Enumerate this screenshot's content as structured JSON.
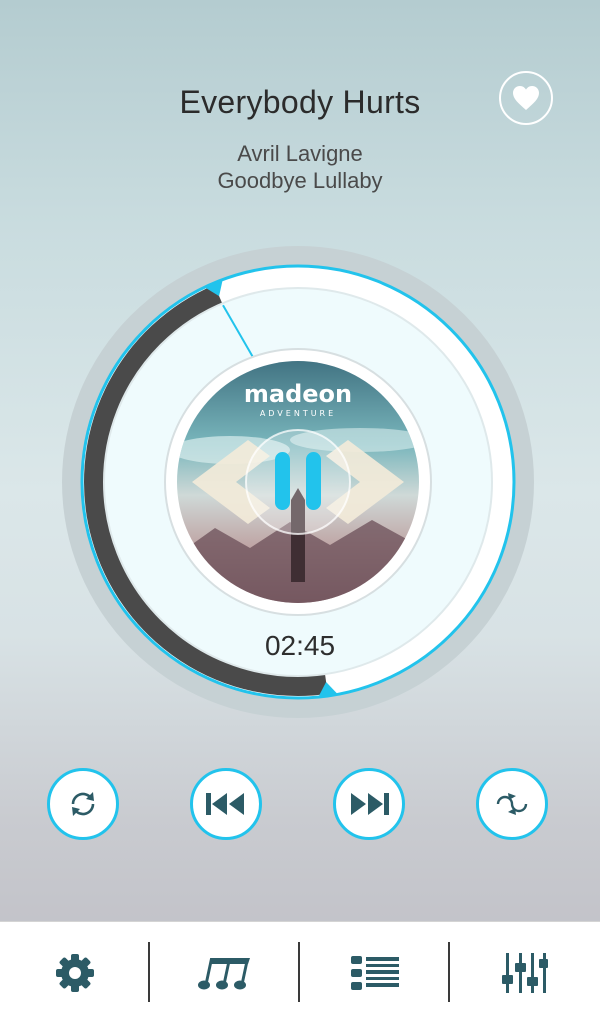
{
  "track": {
    "title": "Everybody Hurts",
    "artist": "Avril Lavigne",
    "album": "Goodbye Lullaby",
    "elapsed": "02:45",
    "progress_fraction": 0.58,
    "album_art_text": "madeon",
    "album_art_subtext": "ADVENTURE"
  },
  "colors": {
    "accent": "#22c3ec",
    "icon_dark": "#2c5b66",
    "progress_dark": "#4a4a4a"
  },
  "controls": [
    {
      "name": "repeat-button",
      "icon": "repeat-icon"
    },
    {
      "name": "previous-button",
      "icon": "skip-back-icon"
    },
    {
      "name": "next-button",
      "icon": "skip-forward-icon"
    },
    {
      "name": "shuffle-button",
      "icon": "shuffle-icon"
    }
  ],
  "tabs": [
    {
      "name": "tab-settings",
      "icon": "gear-icon"
    },
    {
      "name": "tab-music",
      "icon": "music-notes-icon"
    },
    {
      "name": "tab-playlist",
      "icon": "list-icon"
    },
    {
      "name": "tab-equalizer",
      "icon": "equalizer-icon"
    }
  ]
}
